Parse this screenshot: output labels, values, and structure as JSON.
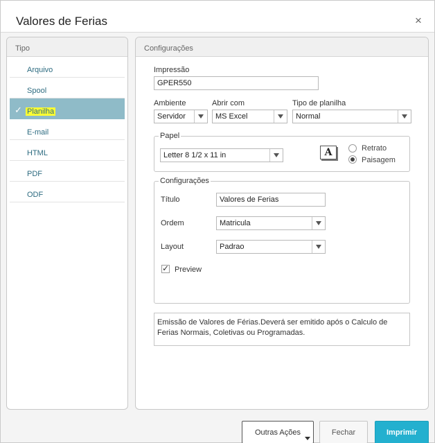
{
  "dialog": {
    "title": "Valores de Ferias",
    "close_glyph": "×"
  },
  "sidebar": {
    "header": "Tipo",
    "items": [
      {
        "label": "Arquivo"
      },
      {
        "label": "Spool"
      },
      {
        "label": "Planilha",
        "active": true
      },
      {
        "label": "E-mail"
      },
      {
        "label": "HTML"
      },
      {
        "label": "PDF"
      },
      {
        "label": "ODF"
      }
    ]
  },
  "config": {
    "header": "Configurações",
    "impressao": {
      "label": "Impressão",
      "value": "GPER550"
    },
    "ambiente": {
      "label": "Ambiente",
      "value": "Servidor"
    },
    "abrir_com": {
      "label": "Abrir com",
      "value": "MS Excel"
    },
    "tipo_planilha": {
      "label": "Tipo de planilha",
      "value": "Normal"
    },
    "papel": {
      "legend": "Papel",
      "size": "Letter 8 1/2 x 11 in",
      "icon_glyph": "A",
      "orientation": {
        "retrato": "Retrato",
        "paisagem": "Paisagem",
        "selected": "Paisagem"
      }
    },
    "configuracoes": {
      "legend": "Configurações",
      "titulo": {
        "label": "Título",
        "value": "Valores de Ferias"
      },
      "ordem": {
        "label": "Ordem",
        "value": "Matricula"
      },
      "layout": {
        "label": "Layout",
        "value": "Padrao"
      },
      "preview": {
        "label": "Preview",
        "checked": true
      }
    },
    "description": "Emissão de Valores de Férias.Deverá ser emitido após o Calculo de Ferias Normais, Coletivas ou Programadas."
  },
  "footer": {
    "outras_acoes": "Outras Ações",
    "fechar": "Fechar",
    "imprimir": "Imprimir"
  },
  "colors": {
    "accent": "#23b0cf",
    "selected_row": "#8fbbc8",
    "highlight": "#ffff33",
    "link": "#2d6b80"
  }
}
